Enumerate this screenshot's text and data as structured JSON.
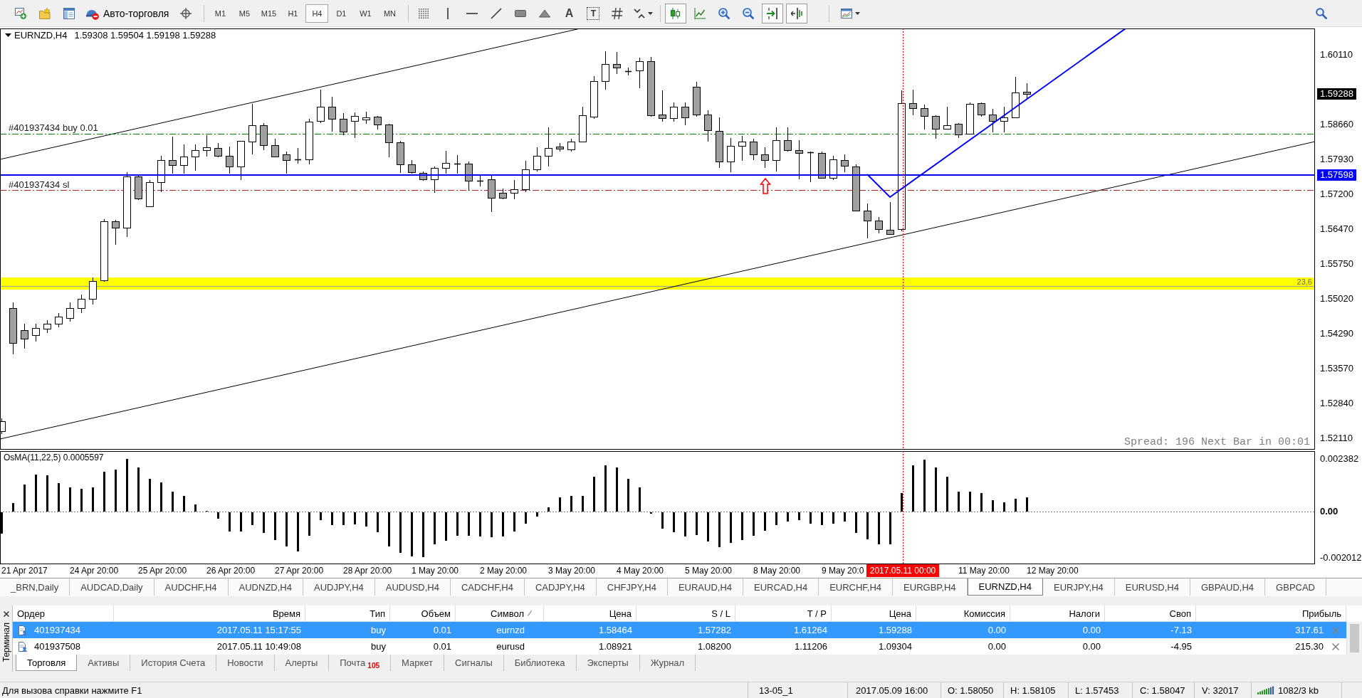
{
  "toolbar": {
    "auto_trading": {
      "label": "Авто-торговля",
      "on": false
    },
    "periods": [
      {
        "label": "M1",
        "selected": false
      },
      {
        "label": "M5",
        "selected": false
      },
      {
        "label": "M15",
        "selected": false
      },
      {
        "label": "H1",
        "selected": false
      },
      {
        "label": "H4",
        "selected": true
      },
      {
        "label": "D1",
        "selected": false
      },
      {
        "label": "W1",
        "selected": false
      },
      {
        "label": "MN",
        "selected": false
      }
    ],
    "text_tool": {
      "label": "A"
    },
    "label_tool": {
      "label": "T"
    },
    "chart_type_buttons": [
      {
        "pressed": true
      },
      {
        "pressed": false
      }
    ],
    "scroll_buttons": [
      {
        "pressed": true
      },
      {
        "pressed": true
      }
    ]
  },
  "chart": {
    "symbol": "EURNZD,H4",
    "ohlc": "1.59308 1.59504 1.59198 1.59288",
    "order_labels": [
      "#401937434 buy 0.01",
      "#401937434 sl"
    ],
    "level_label": "23,6",
    "info": "Spread: 196 Next Bar in 00:01",
    "price_axis": [
      "1.60110",
      "1.58660",
      "1.57930",
      "1.57200",
      "1.56470",
      "1.55750",
      "1.55020",
      "1.54290",
      "1.53570",
      "1.52840",
      "1.52110"
    ],
    "bid_tag": "1.59288",
    "line_tag": "1.57598"
  },
  "indicator": {
    "title": "OsMA(11,22,5) 0.0005597",
    "axis": [
      "0.002382",
      "0.00",
      "-0.002012"
    ]
  },
  "time_axis": {
    "labels": [
      "21 Apr 2017",
      "24 Apr 20:00",
      "25 Apr 20:00",
      "26 Apr 20:00",
      "27 Apr 20:00",
      "28 Apr 20:00",
      "1 May 20:00",
      "2 May 20:00",
      "3 May 20:00",
      "4 May 20:00",
      "5 May 20:00",
      "8 May 20:00",
      "9 May 20:0",
      "11 May 20:00",
      "12 May 20:00"
    ],
    "cursor_label": "2017.05.11 00:00"
  },
  "symbol_tabs": [
    {
      "label": "_BRN,Daily",
      "selected": false
    },
    {
      "label": "AUDCAD,Daily",
      "selected": false
    },
    {
      "label": "AUDCHF,H4",
      "selected": false
    },
    {
      "label": "AUDNZD,H4",
      "selected": false
    },
    {
      "label": "AUDJPY,H4",
      "selected": false
    },
    {
      "label": "AUDUSD,H4",
      "selected": false
    },
    {
      "label": "CADCHF,H4",
      "selected": false
    },
    {
      "label": "CADJPY,H4",
      "selected": false
    },
    {
      "label": "CHFJPY,H4",
      "selected": false
    },
    {
      "label": "EURAUD,H4",
      "selected": false
    },
    {
      "label": "EURCAD,H4",
      "selected": false
    },
    {
      "label": "EURCHF,H4",
      "selected": false
    },
    {
      "label": "EURGBP,H4",
      "selected": false
    },
    {
      "label": "EURNZD,H4",
      "selected": true
    },
    {
      "label": "EURJPY,H4",
      "selected": false
    },
    {
      "label": "EURUSD,H4",
      "selected": false
    },
    {
      "label": "GBPAUD,H4",
      "selected": false
    },
    {
      "label": "GBPCAD",
      "selected": false
    }
  ],
  "terminal": {
    "title": "Терминал",
    "columns": [
      {
        "label": "Ордер",
        "sorted": false
      },
      {
        "label": "Время",
        "sorted": false
      },
      {
        "label": "Тип",
        "sorted": false
      },
      {
        "label": "Объем",
        "sorted": false
      },
      {
        "label": "Символ",
        "sorted": true
      },
      {
        "label": "Цена",
        "sorted": false
      },
      {
        "label": "S / L",
        "sorted": false
      },
      {
        "label": "T / P",
        "sorted": false
      },
      {
        "label": "Цена",
        "sorted": false
      },
      {
        "label": "Комиссия",
        "sorted": false
      },
      {
        "label": "Налоги",
        "sorted": false
      },
      {
        "label": "Своп",
        "sorted": false
      },
      {
        "label": "Прибыль",
        "sorted": false
      }
    ],
    "rows": [
      {
        "selected": true,
        "cells": [
          "401937434",
          "2017.05.11 15:17:55",
          "buy",
          "0.01",
          "eurnzd",
          "1.58464",
          "1.57282",
          "1.61264",
          "1.59288",
          "0.00",
          "0.00",
          "-7.13",
          "317.61"
        ]
      },
      {
        "selected": false,
        "cells": [
          "401937508",
          "2017.05.11 10:49:08",
          "buy",
          "0.01",
          "eurusd",
          "1.08921",
          "1.08200",
          "1.11206",
          "1.09304",
          "0.00",
          "0.00",
          "-4.95",
          "215.30"
        ]
      }
    ],
    "tabs": [
      {
        "label": "Торговля",
        "selected": true
      },
      {
        "label": "Активы",
        "selected": false
      },
      {
        "label": "История Счета",
        "selected": false
      },
      {
        "label": "Новости",
        "selected": false
      },
      {
        "label": "Алерты",
        "selected": false
      },
      {
        "label": "Почта",
        "selected": false,
        "badge": "105"
      },
      {
        "label": "Маркет",
        "selected": false
      },
      {
        "label": "Сигналы",
        "selected": false
      },
      {
        "label": "Библиотека",
        "selected": false
      },
      {
        "label": "Эксперты",
        "selected": false
      },
      {
        "label": "Журнал",
        "selected": false
      }
    ]
  },
  "status_bar": {
    "help": "Для вызова справки нажмите F1",
    "profile": "13-05_1",
    "bar_time": "2017.05.09 16:00",
    "open": "O: 1.58050",
    "high": "H: 1.58105",
    "low": "L: 1.57453",
    "close": "C: 1.58047",
    "volume": "V: 32017",
    "traffic": "1082/3 kb"
  }
}
